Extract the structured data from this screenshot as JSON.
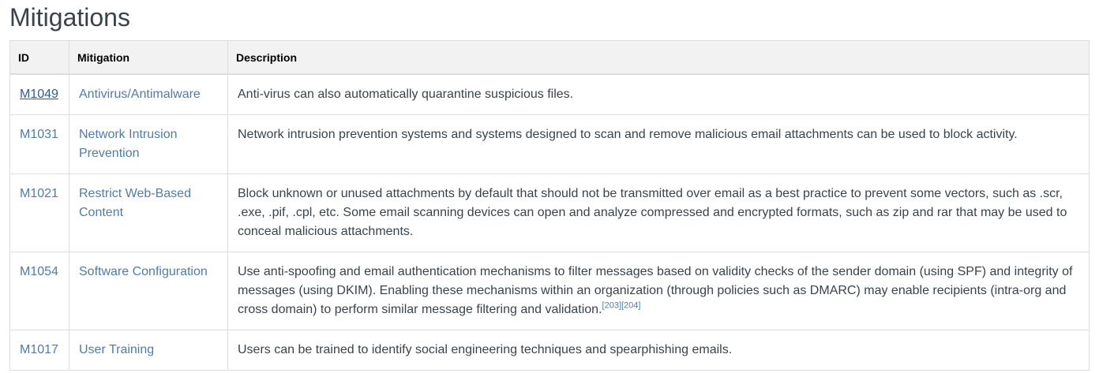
{
  "section": {
    "title": "Mitigations"
  },
  "table": {
    "headers": {
      "id": "ID",
      "mitigation": "Mitigation",
      "description": "Description"
    },
    "rows": [
      {
        "id": "M1049",
        "mitigation": "Antivirus/Antimalware",
        "description": "Anti-virus can also automatically quarantine suspicious files."
      },
      {
        "id": "M1031",
        "mitigation": "Network Intrusion Prevention",
        "description": "Network intrusion prevention systems and systems designed to scan and remove malicious email attachments can be used to block activity."
      },
      {
        "id": "M1021",
        "mitigation": "Restrict Web-Based Content",
        "description": "Block unknown or unused attachments by default that should not be transmitted over email as a best practice to prevent some vectors, such as .scr, .exe, .pif, .cpl, etc. Some email scanning devices can open and analyze compressed and encrypted formats, such as zip and rar that may be used to conceal malicious attachments."
      },
      {
        "id": "M1054",
        "mitigation": "Software Configuration",
        "description": "Use anti-spoofing and email authentication mechanisms to filter messages based on validity checks of the sender domain (using SPF) and integrity of messages (using DKIM). Enabling these mechanisms within an organization (through policies such as DMARC) may enable recipients (intra-org and cross domain) to perform similar message filtering and validation.",
        "citations": [
          "[203]",
          "[204]"
        ]
      },
      {
        "id": "M1017",
        "mitigation": "User Training",
        "description": "Users can be trained to identify social engineering techniques and spearphishing emails."
      }
    ]
  },
  "colors": {
    "link": "#4f7cac",
    "link_visited": "#2c5e99",
    "text": "#39434c",
    "header_bg": "#f2f2f2",
    "border": "#dddddd"
  }
}
